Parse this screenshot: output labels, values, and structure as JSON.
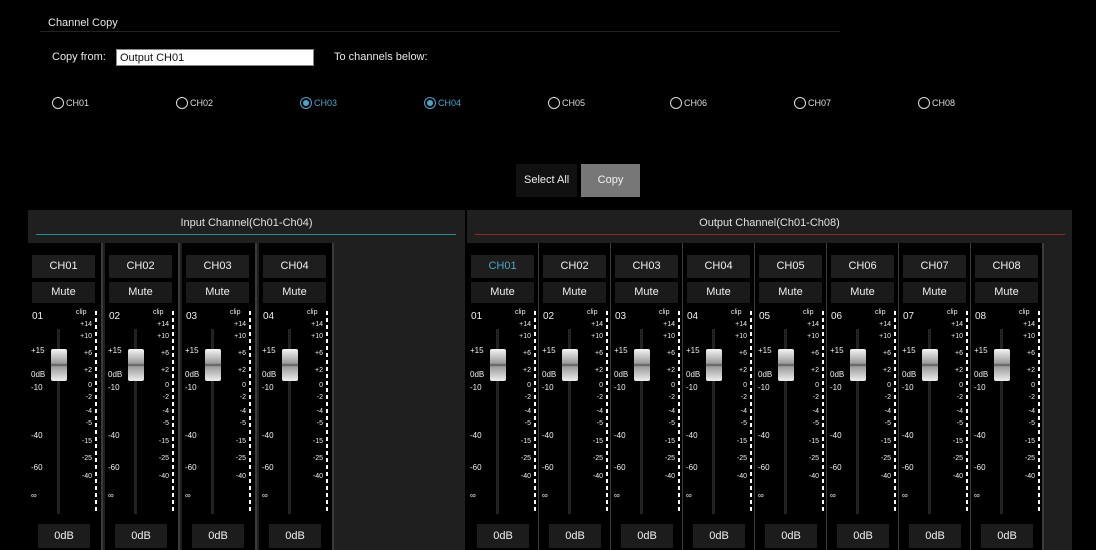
{
  "copy": {
    "title": "Channel Copy",
    "from_label": "Copy from:",
    "from_value": "Output CH01",
    "to_label": "To channels below:",
    "targets": [
      {
        "label": "CH01",
        "checked": false
      },
      {
        "label": "CH02",
        "checked": false
      },
      {
        "label": "CH03",
        "checked": true
      },
      {
        "label": "CH04",
        "checked": true
      },
      {
        "label": "CH05",
        "checked": false
      },
      {
        "label": "CH06",
        "checked": false
      },
      {
        "label": "CH07",
        "checked": false
      },
      {
        "label": "CH08",
        "checked": false
      }
    ],
    "select_all_label": "Select All",
    "copy_label": "Copy"
  },
  "input_panel": {
    "title": "Input Channel(Ch01-Ch04)",
    "accent": "#2a8a9a",
    "channels": [
      {
        "name": "CH01",
        "mute": "Mute",
        "num": "01",
        "gain": "0dB"
      },
      {
        "name": "CH02",
        "mute": "Mute",
        "num": "02",
        "gain": "0dB"
      },
      {
        "name": "CH03",
        "mute": "Mute",
        "num": "03",
        "gain": "0dB"
      },
      {
        "name": "CH04",
        "mute": "Mute",
        "num": "04",
        "gain": "0dB"
      }
    ]
  },
  "output_panel": {
    "title": "Output Channel(Ch01-Ch08)",
    "accent": "#8a2a2a",
    "channels": [
      {
        "name": "CH01",
        "mute": "Mute",
        "num": "01",
        "gain": "0dB",
        "selected": true
      },
      {
        "name": "CH02",
        "mute": "Mute",
        "num": "02",
        "gain": "0dB"
      },
      {
        "name": "CH03",
        "mute": "Mute",
        "num": "03",
        "gain": "0dB"
      },
      {
        "name": "CH04",
        "mute": "Mute",
        "num": "04",
        "gain": "0dB"
      },
      {
        "name": "CH05",
        "mute": "Mute",
        "num": "05",
        "gain": "0dB"
      },
      {
        "name": "CH06",
        "mute": "Mute",
        "num": "06",
        "gain": "0dB"
      },
      {
        "name": "CH07",
        "mute": "Mute",
        "num": "07",
        "gain": "0dB"
      },
      {
        "name": "CH08",
        "mute": "Mute",
        "num": "08",
        "gain": "0dB"
      }
    ]
  },
  "strip_labels": {
    "clip": "clip",
    "fader_scale": [
      "+15",
      "0dB",
      "-10",
      "-40",
      "-60",
      "∞"
    ],
    "meter_scale": [
      "+14",
      "+10",
      "+6",
      "+2",
      "0",
      "-2",
      "-4",
      "-5",
      "-15",
      "-25",
      "-40"
    ]
  },
  "accent_color": "#4aa6c9"
}
